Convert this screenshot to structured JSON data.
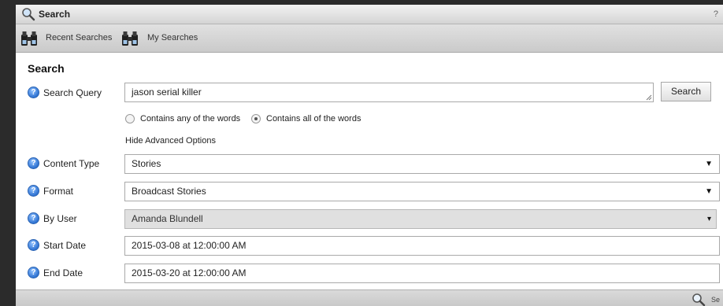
{
  "window": {
    "title": "Search",
    "help_glyph": "?"
  },
  "toolbar": {
    "items": [
      {
        "label": "Recent Searches",
        "icon": "binoculars-icon"
      },
      {
        "label": "My Searches",
        "icon": "binoculars-icon"
      }
    ]
  },
  "section": {
    "heading": "Search"
  },
  "query": {
    "label": "Search Query",
    "value": "jason serial killer",
    "button_label": "Search"
  },
  "match_mode": {
    "options": [
      "Contains any of the words",
      "Contains all of the words"
    ],
    "selected": "Contains all of the words"
  },
  "advanced_toggle_label": "Hide Advanced Options",
  "content_type": {
    "label": "Content Type",
    "value": "Stories"
  },
  "format": {
    "label": "Format",
    "value": "Broadcast Stories"
  },
  "by_user": {
    "label": "By User",
    "value": "Amanda Blundell"
  },
  "start_date": {
    "label": "Start Date",
    "value": "2015-03-08 at 12:00:00 AM"
  },
  "end_date": {
    "label": "End Date",
    "value": "2015-03-20 at 12:00:00 AM"
  },
  "footer": {
    "search_label": "Se"
  },
  "icons": {
    "help": "help-icon",
    "search": "search-icon",
    "dropdown": "chevron-down-icon"
  }
}
